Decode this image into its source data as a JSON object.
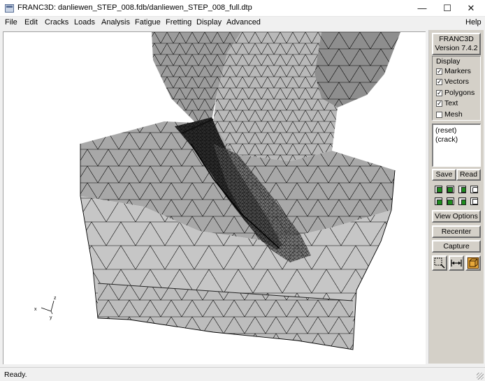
{
  "window": {
    "title": "FRANC3D: danliewen_STEP_008.fdb/danliewen_STEP_008_full.dtp",
    "minimize": "—",
    "maximize": "☐",
    "close": "✕"
  },
  "menu": {
    "items": [
      "File",
      "Edit",
      "Cracks",
      "Loads",
      "Analysis",
      "Fatigue",
      "Fretting",
      "Display",
      "Advanced"
    ],
    "help": "Help"
  },
  "panel": {
    "app_name": "FRANC3D",
    "version": "Version 7.4.2",
    "display_title": "Display",
    "display_options": [
      {
        "label": "Markers",
        "checked": true
      },
      {
        "label": "Vectors",
        "checked": true
      },
      {
        "label": "Polygons",
        "checked": true
      },
      {
        "label": "Text",
        "checked": true
      },
      {
        "label": "Mesh",
        "checked": false
      }
    ],
    "view_list": [
      "(reset)",
      "(crack)"
    ],
    "save": "Save",
    "read": "Read",
    "view_options": "View Options",
    "recenter": "Recenter",
    "capture": "Capture",
    "colors": {
      "green": "#1e8c1e",
      "panel": "#d4d0c8"
    }
  },
  "axes": {
    "x": "x",
    "y": "y",
    "z": "z"
  },
  "status": "Ready."
}
